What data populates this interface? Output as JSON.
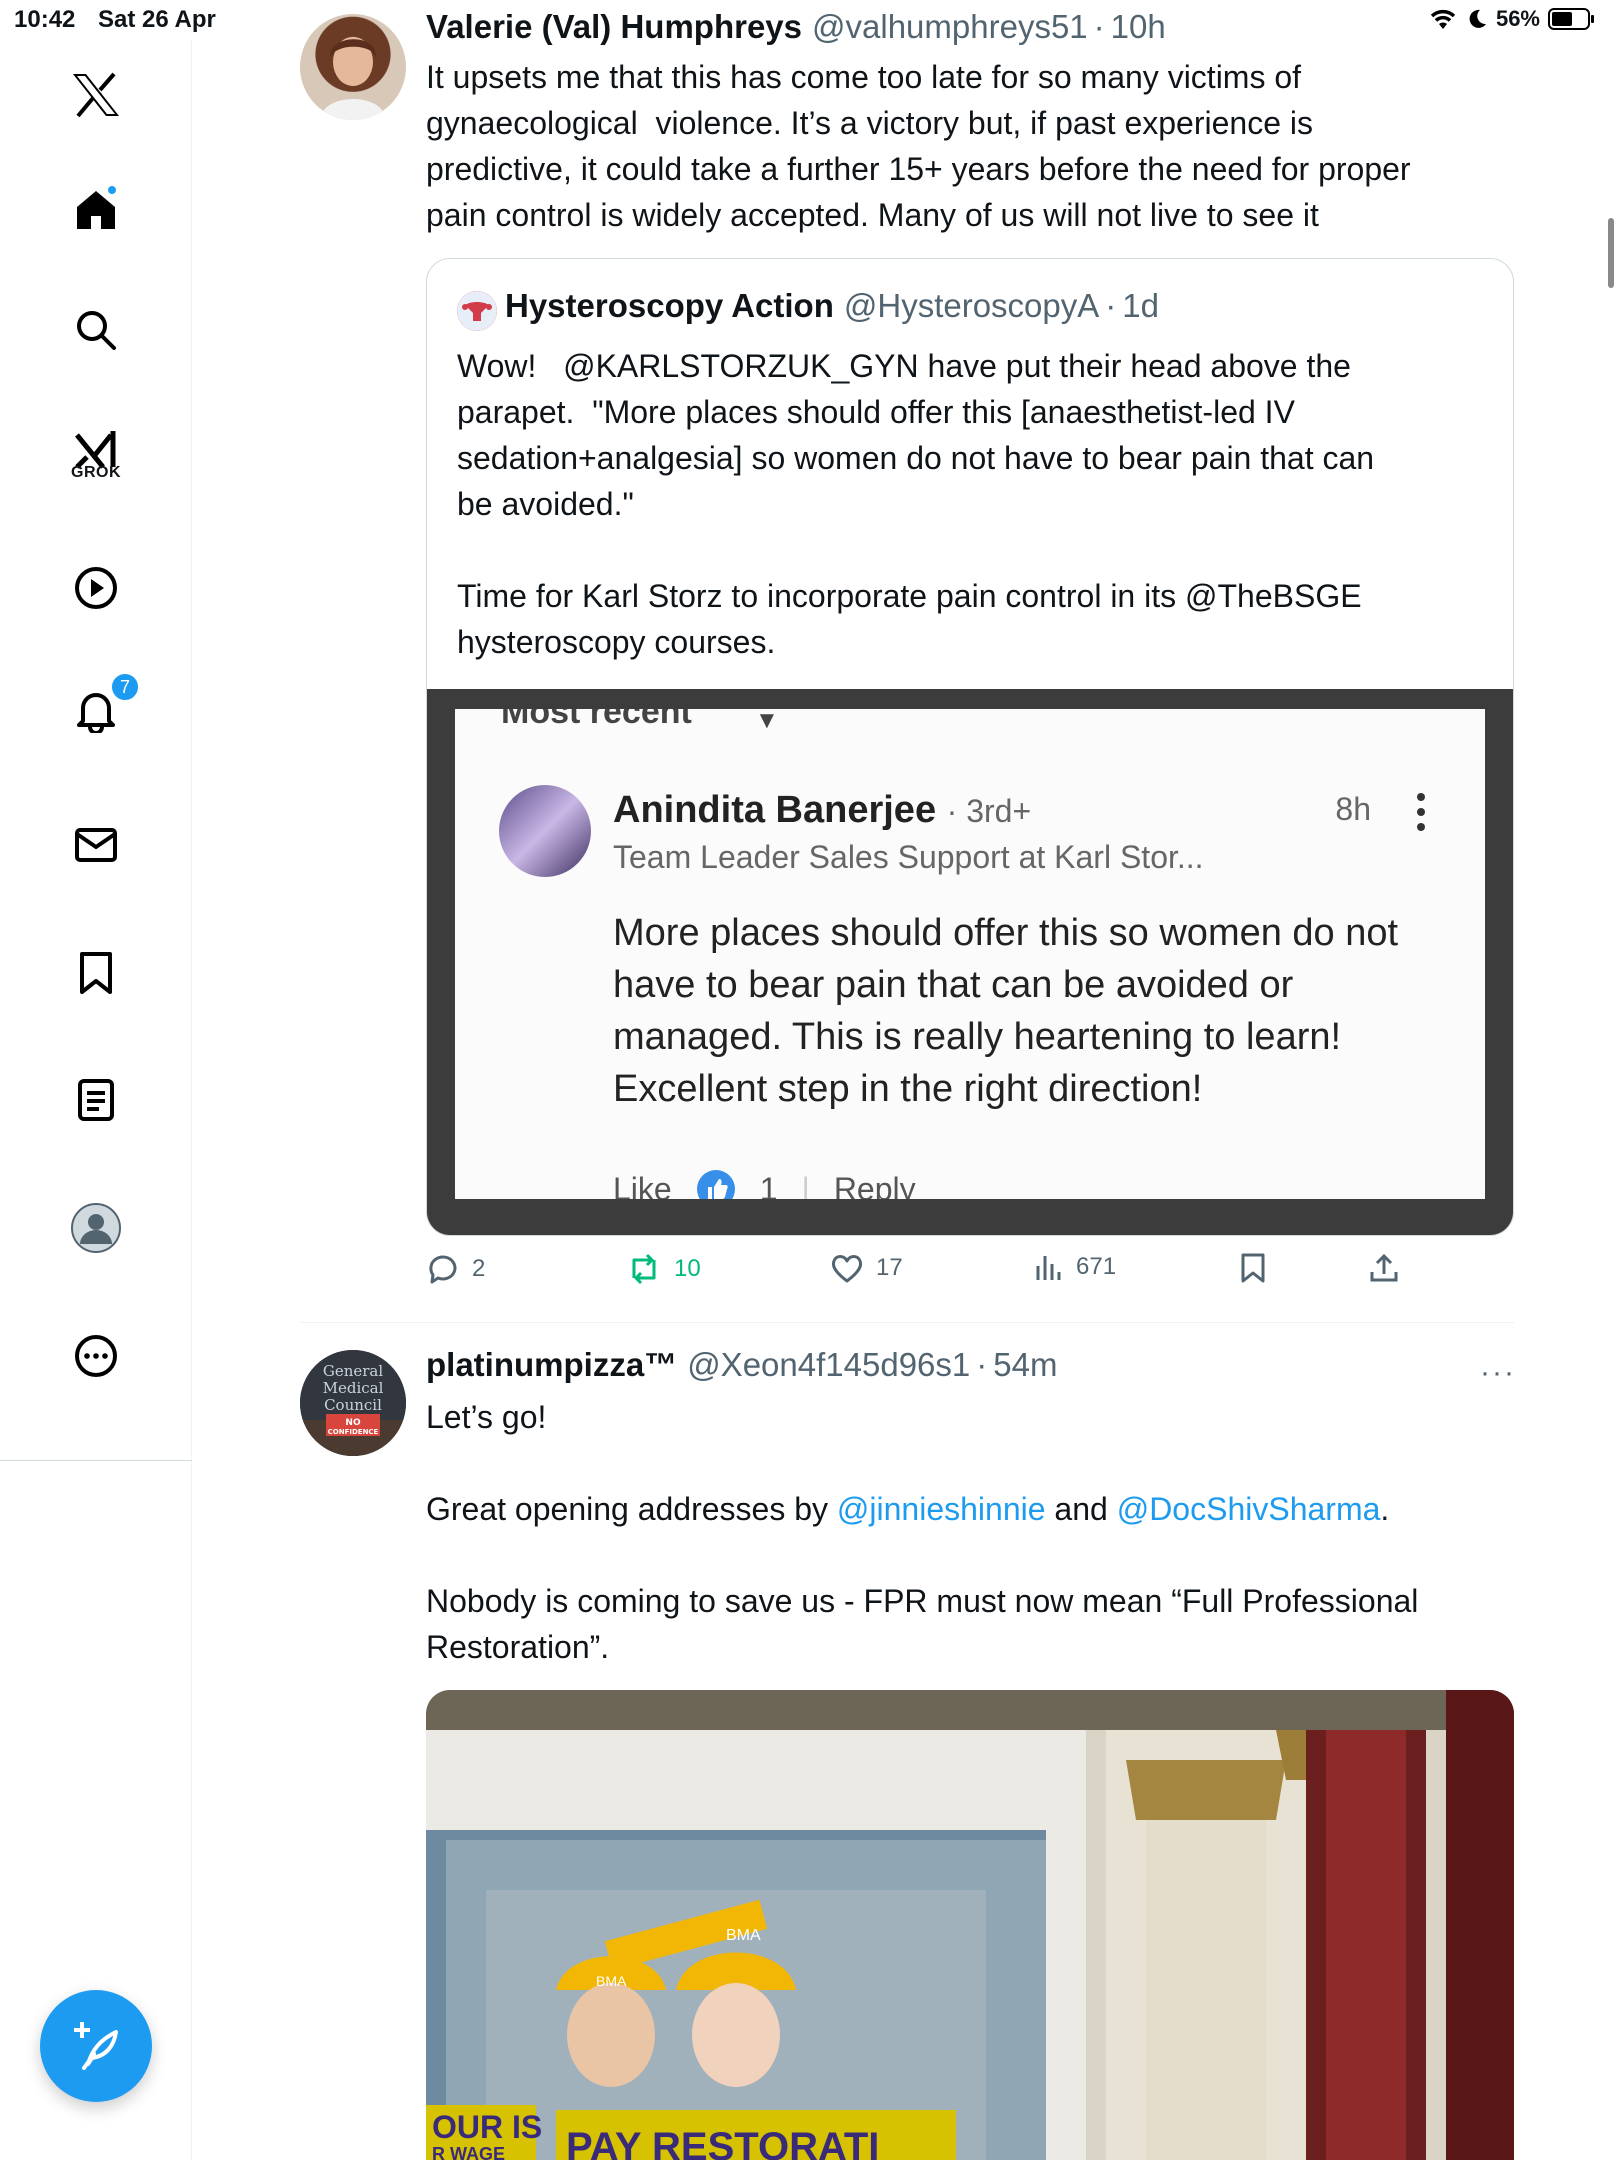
{
  "status_bar": {
    "time": "10:42",
    "date": "Sat 26 Apr",
    "battery": "56%"
  },
  "sidebar": {
    "grok_label": "GROK",
    "notifications_count": "7"
  },
  "tweets": [
    {
      "name": "Valerie (Val) Humphreys",
      "handle": "@valhumphreys51",
      "time": "10h",
      "text": "It upsets me that this has come too late for so many victims of\ngynaecological  violence. It’s a victory but, if past experience is\npredictive, it could take a further 15+ years before the need for proper\npain control is widely accepted. Many of us will not live to see it",
      "quote": {
        "name": "Hysteroscopy Action",
        "handle": "@HysteroscopyA",
        "time": "1d",
        "text": "Wow!   @KARLSTORZUK_GYN have put their head above the\nparapet.  \"More places should offer this [anaesthetist-led IV\nsedation+analgesia] so women do not have to bear pain that can\nbe avoided.\"\n\nTime for Karl Storz to incorporate pain control in its @TheBSGE\nhysteroscopy courses.",
        "screenshot": {
          "sort_label": "Most recent",
          "commenter_name": "Anindita Banerjee",
          "degree": "· 3rd+",
          "time": "8h",
          "role": "Team Leader Sales Support at Karl Stor...",
          "body": "More places should offer this so women do not have to bear pain that can be avoided or managed. This is really heartening to learn! Excellent step in the right direction!",
          "like_label": "Like",
          "like_count": "1",
          "reply_label": "Reply"
        }
      },
      "stats": {
        "replies": "2",
        "reposts": "10",
        "likes": "17",
        "views": "671"
      }
    },
    {
      "name": "platinumpizza™",
      "handle": "@Xeon4f145d96s1",
      "time": "54m",
      "line1": "Let’s go!",
      "line2_prefix": "Great opening addresses by ",
      "mention1": "@jinnieshinnie",
      "line2_mid": " and ",
      "mention2": "@DocShivSharma",
      "line2_suffix": ".",
      "line3": "Nobody is coming to save us - FPR must now mean “Full Professional\nRestoration”.",
      "avatar_text": [
        "General",
        "Medical",
        "Council",
        "NO",
        "CONFIDENCE"
      ],
      "photo_text": [
        "BMA",
        "BMA",
        "OUR IS",
        "R WAGE",
        "PAY RESTORATI"
      ]
    }
  ],
  "colors": {
    "accent": "#1d9bf0",
    "repost_green": "#00ba7c",
    "muted": "#536471"
  },
  "icons": [
    "x-logo-icon",
    "home-icon",
    "search-icon",
    "grok-icon",
    "video-icon",
    "bell-icon",
    "mail-icon",
    "bookmark-icon",
    "lists-icon",
    "profile-icon",
    "more-icon",
    "compose-icon"
  ]
}
